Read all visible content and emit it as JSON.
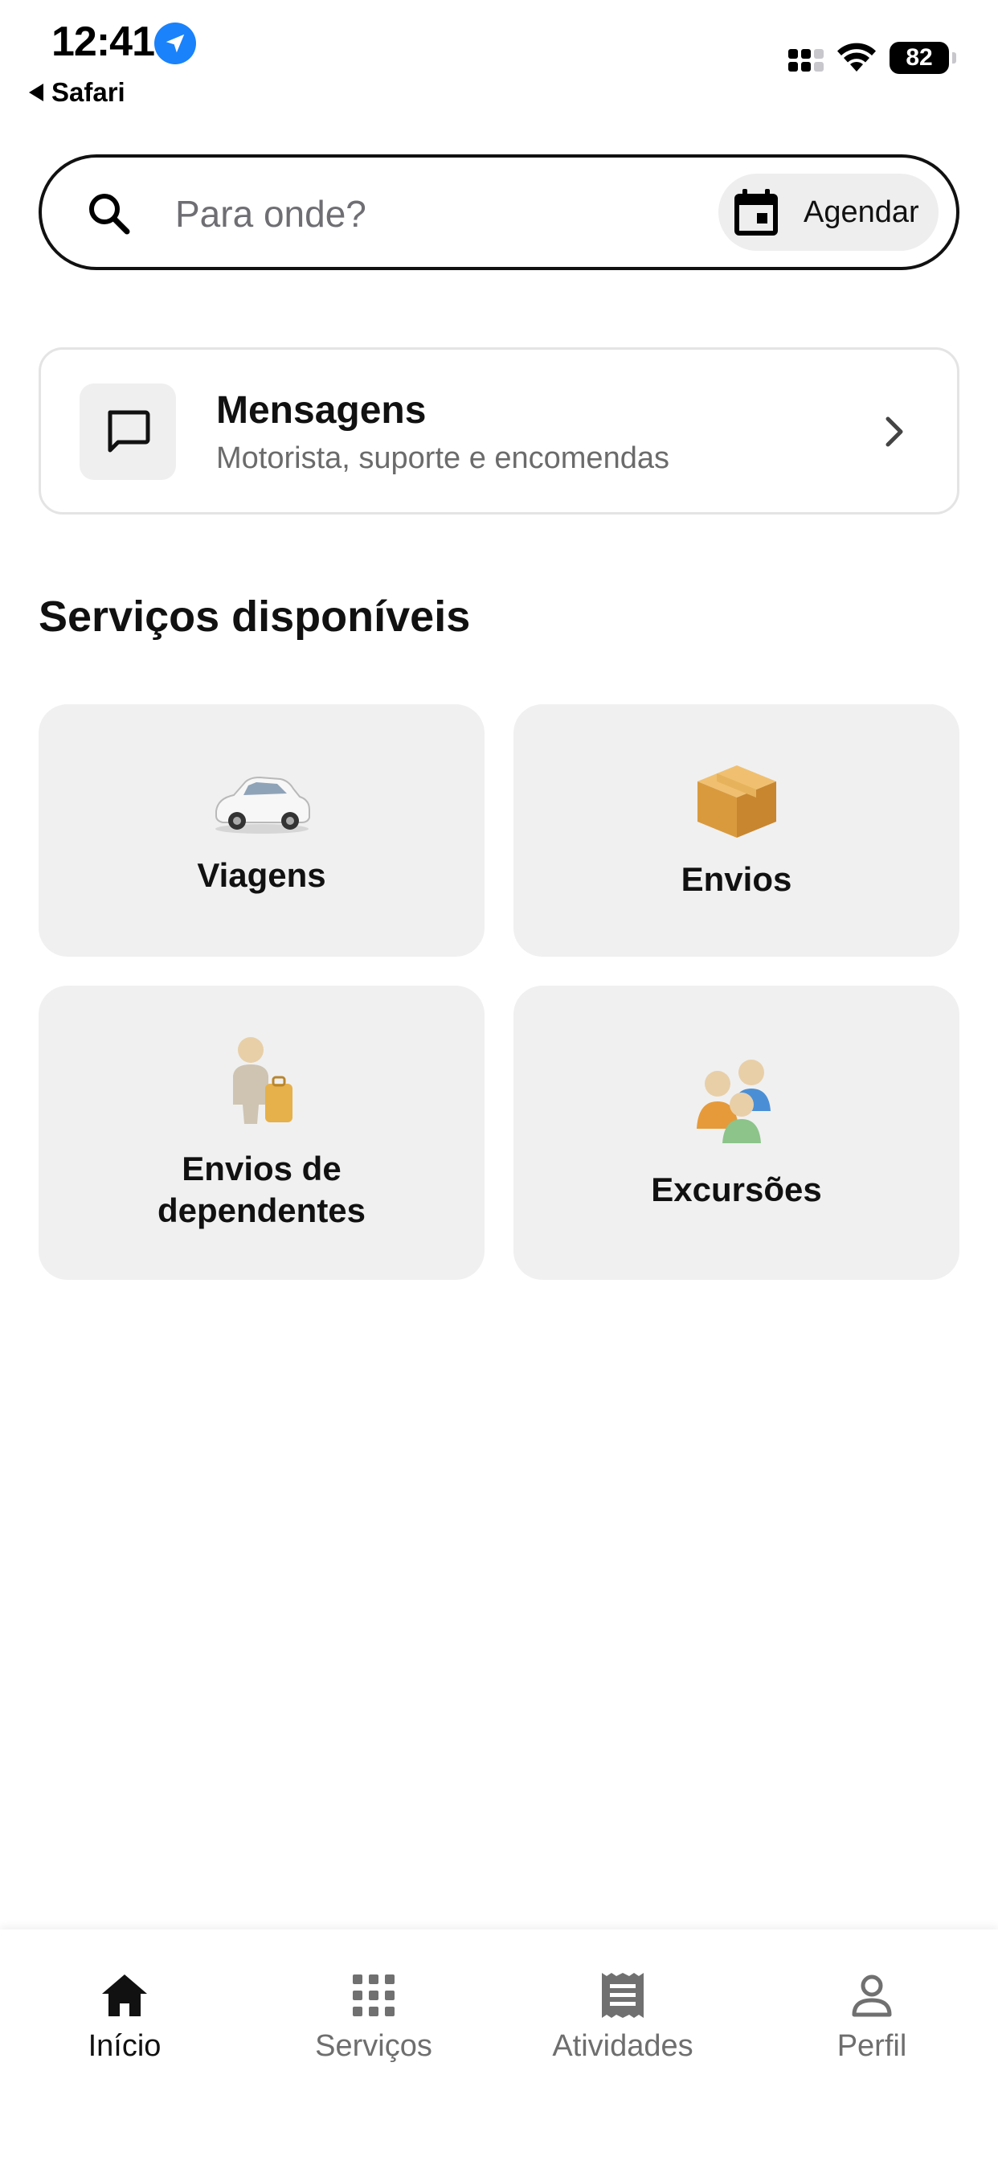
{
  "status_bar": {
    "time": "12:41",
    "back_app": "Safari",
    "battery": "82"
  },
  "search": {
    "placeholder": "Para onde?",
    "schedule_label": "Agendar"
  },
  "messages": {
    "title": "Mensagens",
    "subtitle": "Motorista, suporte e encomendas"
  },
  "services": {
    "title": "Serviços disponíveis",
    "items": [
      {
        "label": "Viagens",
        "icon": "car-icon"
      },
      {
        "label": "Envios",
        "icon": "package-icon"
      },
      {
        "label": "Envios de dependentes",
        "icon": "traveler-luggage-icon"
      },
      {
        "label": "Excursões",
        "icon": "group-people-icon"
      }
    ]
  },
  "tabs": [
    {
      "label": "Início",
      "icon": "home-icon",
      "active": true
    },
    {
      "label": "Serviços",
      "icon": "grid-icon",
      "active": false
    },
    {
      "label": "Atividades",
      "icon": "receipt-icon",
      "active": false
    },
    {
      "label": "Perfil",
      "icon": "person-icon",
      "active": false
    }
  ],
  "colors": {
    "accent_location": "#1a82fb",
    "card_background": "#f0f0f0",
    "text_primary": "#111111",
    "text_secondary": "#6e6e6e",
    "package_gold": "#e0a44a"
  }
}
